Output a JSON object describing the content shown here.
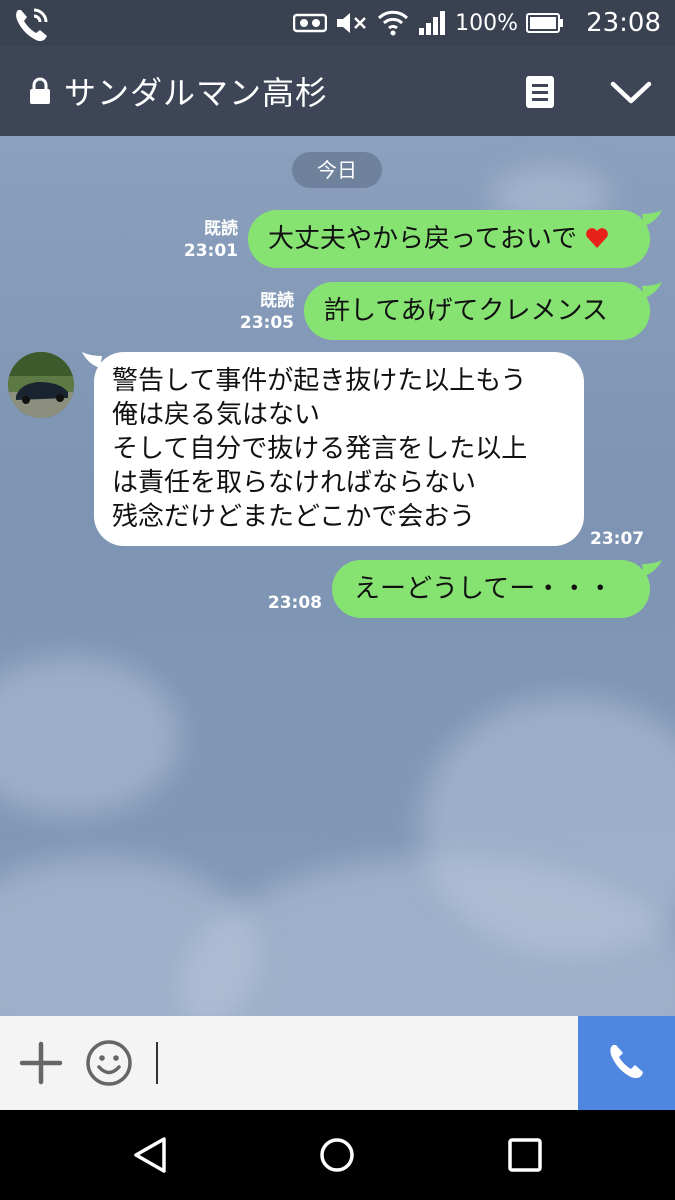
{
  "status_bar": {
    "battery": "100%",
    "time": "23:08",
    "icons": [
      "phone-call-icon",
      "signal-icon",
      "mute-icon",
      "wifi-icon",
      "cellular-icon",
      "battery-icon"
    ]
  },
  "header": {
    "title": "サンダルマン高杉",
    "icons": [
      "lock-icon",
      "note-icon",
      "chevron-down-icon"
    ]
  },
  "chat": {
    "date_separator": "今日",
    "messages": [
      {
        "from": "me",
        "text": "大丈夫やから戻っておいで",
        "read": "既読",
        "time": "23:01",
        "emoji": "heart-icon"
      },
      {
        "from": "me",
        "text": "許してあげてクレメンス",
        "read": "既読",
        "time": "23:05"
      },
      {
        "from": "other",
        "lines": [
          "警告して事件が起き抜けた以上もう",
          "俺は戻る気はない",
          "そして自分で抜ける発言をした以上",
          "は責任を取らなければならない",
          "残念だけどまたどこかで会おう"
        ],
        "time": "23:07"
      },
      {
        "from": "me",
        "text": "えーどうしてー・・・",
        "time": "23:08"
      }
    ]
  },
  "input_bar": {
    "icons": [
      "plus-icon",
      "emoji-icon",
      "call-icon"
    ]
  },
  "colors": {
    "sent_bubble": "#86e372",
    "received_bubble": "#ffffff",
    "header_bg": "#3e4557",
    "call_button": "#4f86e0"
  }
}
